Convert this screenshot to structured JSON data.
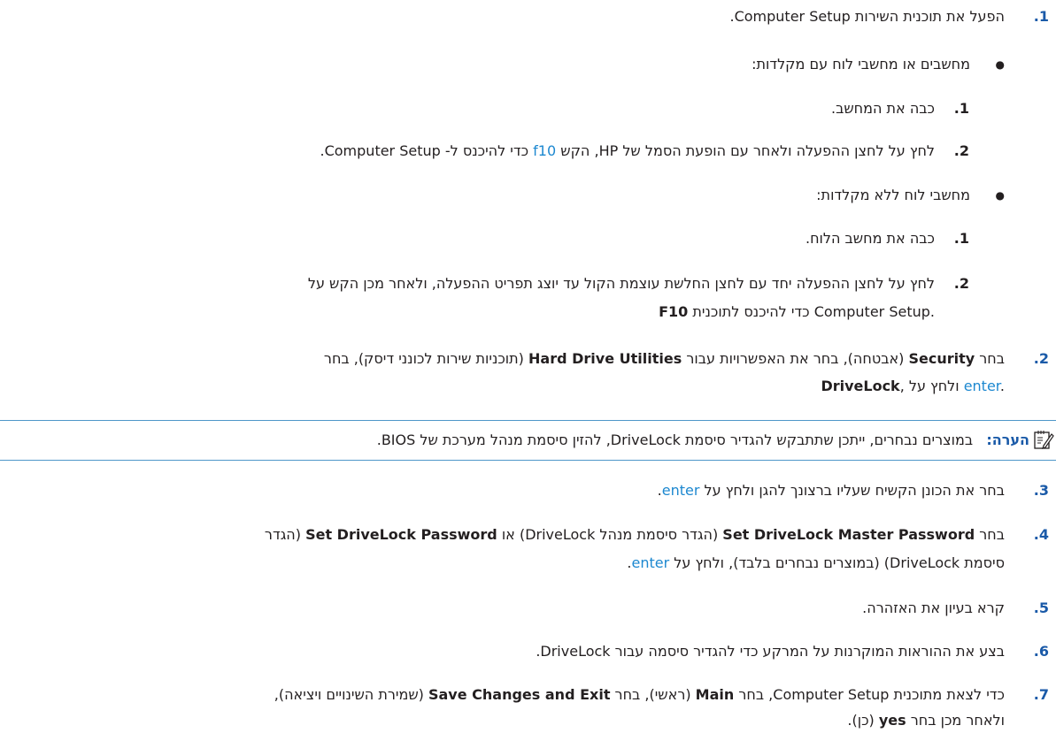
{
  "steps": {
    "s1": {
      "num": ".1",
      "text": "הפעל את תוכנית השירות Computer Setup.",
      "with_keyboard": {
        "title": "מחשבים או מחשבי לוח עם מקלדות:",
        "a": {
          "num": ".1",
          "text": "כבה את המחשב."
        },
        "b": {
          "num": ".2",
          "text_pre": "לחץ על לחצן ההפעלה ולאחר עם הופעת הסמל של HP, הקש ",
          "key": "f10",
          "text_post": " כדי להיכנס ל- Computer Setup."
        }
      },
      "without_keyboard": {
        "title": "מחשבי לוח ללא מקלדות:",
        "a": {
          "num": ".1",
          "text": "כבה את מחשב הלוח."
        },
        "b": {
          "num": ".2",
          "line1": "לחץ על לחצן ההפעלה יחד עם לחצן החלשת עוצמת הקול עד יוצג תפריט ההפעלה, ולאחר מכן הקש על",
          "line2_key": "F10",
          "line2_text": " כדי להיכנס לתוכנית Computer Setup."
        }
      }
    },
    "s2": {
      "num": ".2",
      "l1_pre": "בחר ",
      "l1_b1": "Security",
      "l1_mid": " (אבטחה), בחר את האפשרויות עבור ",
      "l1_b2": "Hard Drive Utilities",
      "l1_post": " (תוכניות שירות לכונני דיסק), בחר",
      "l2_b": "DriveLock",
      "l2_mid": ", ולחץ על ",
      "l2_key": "enter",
      "l2_post": "."
    },
    "note": {
      "label": "הערה:",
      "text": "במוצרים נבחרים, ייתכן שתתבקש להגדיר סיסמת DriveLock, להזין סיסמת מנהל מערכת של BIOS.",
      "icon": "note-pencil-icon"
    },
    "s3": {
      "num": ".3",
      "pre": "בחר את הכונן הקשיח שעליו ברצונך להגן ולחץ על ",
      "key": "enter",
      "post": "."
    },
    "s4": {
      "num": ".4",
      "l1_pre": "בחר ",
      "l1_b1": "Set DriveLock Master Password",
      "l1_mid": " (הגדר סיסמת מנהל DriveLock) או ",
      "l1_b2": "Set DriveLock Password",
      "l1_post": " (הגדר",
      "l2_pre": "סיסמת DriveLock) (במוצרים נבחרים בלבד), ולחץ על ",
      "l2_key": "enter",
      "l2_post": "."
    },
    "s5": {
      "num": ".5",
      "text": "קרא בעיון את האזהרה."
    },
    "s6": {
      "num": ".6",
      "text": "בצע את ההוראות המוקרנות על המרקע כדי להגדיר סיסמה עבור DriveLock."
    },
    "s7": {
      "num": ".7",
      "l1_pre": "כדי לצאת מתוכנית Computer Setup, בחר ",
      "l1_b1": "Main",
      "l1_mid": " (ראשי), בחר ",
      "l1_b2": "Save Changes and Exit",
      "l1_post": " (שמירת השינויים ויציאה),",
      "l2_pre": "ולאחר מכן בחר ",
      "l2_b": "yes",
      "l2_post": " (כן)."
    }
  }
}
